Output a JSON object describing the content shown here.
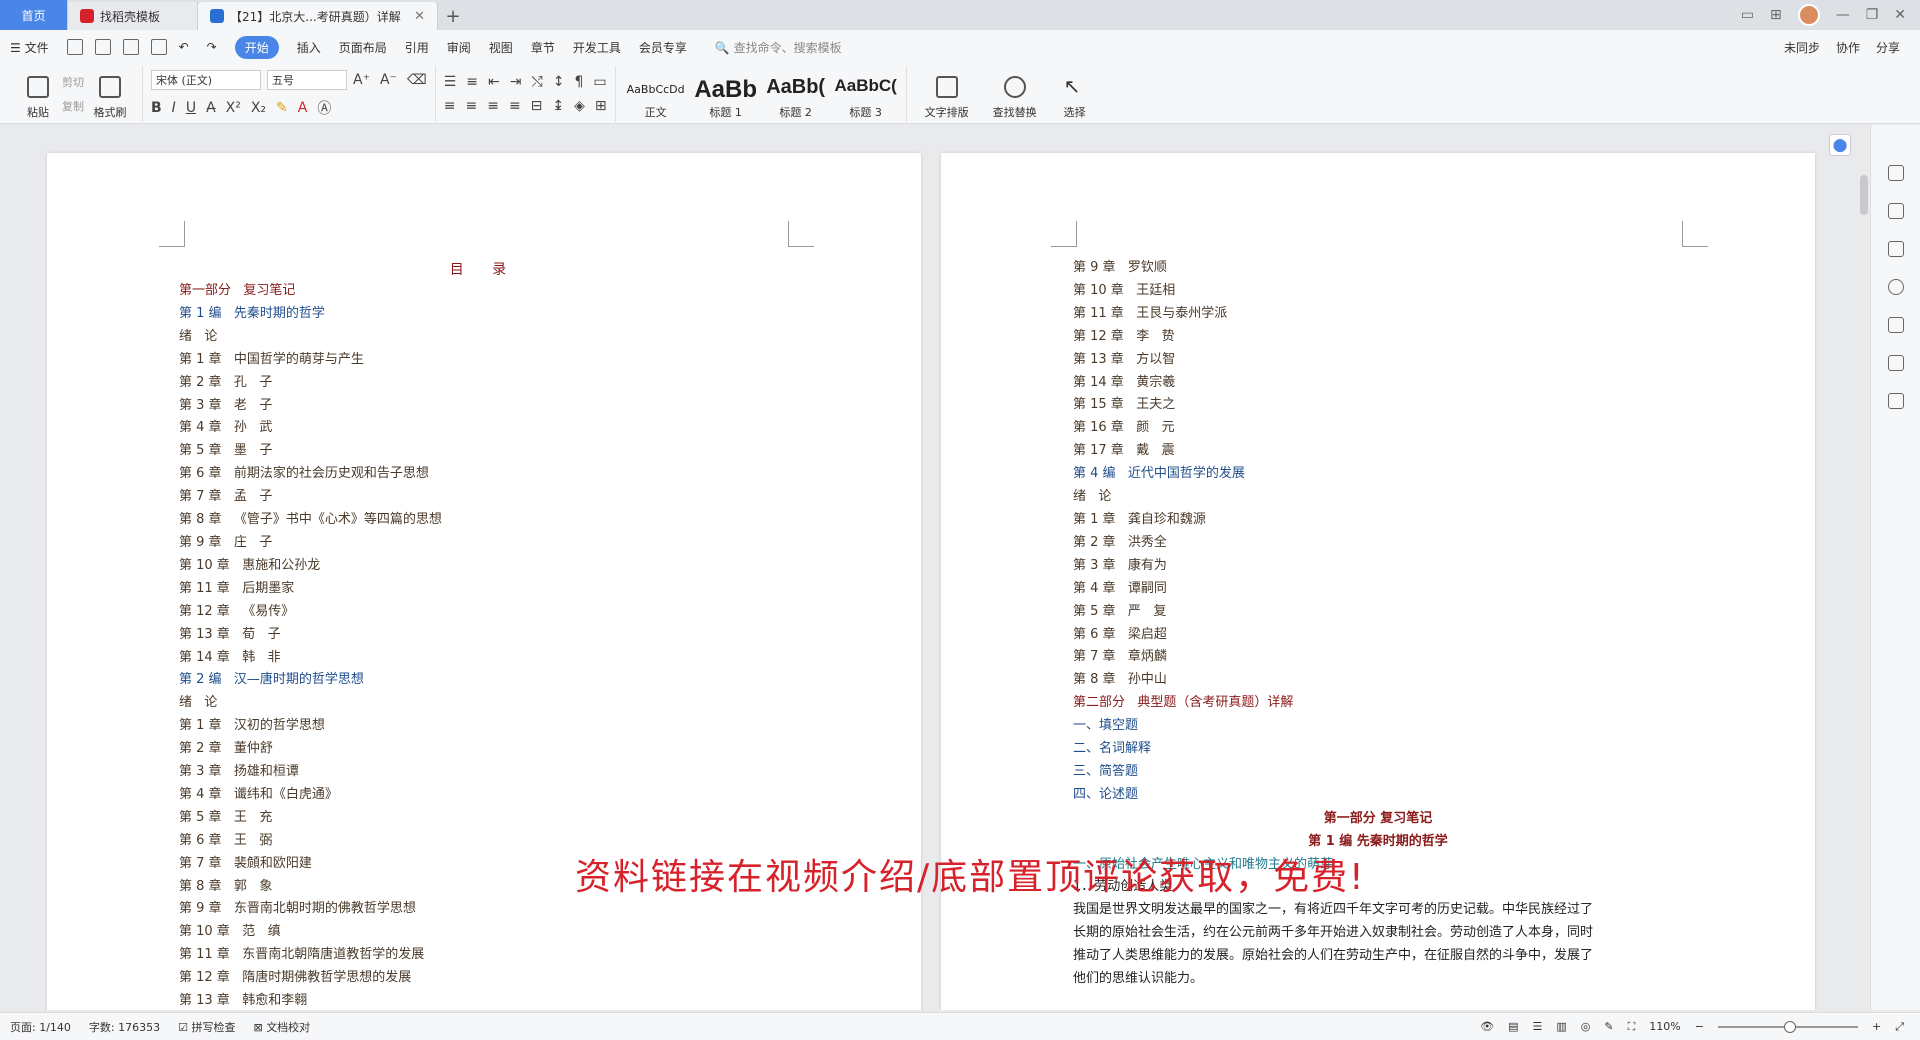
{
  "tabs": {
    "home": "首页",
    "template": "找稻壳模板",
    "doc": "【21】北京大...考研真题）详解"
  },
  "menu": {
    "file": "文件",
    "items": [
      "开始",
      "插入",
      "页面布局",
      "引用",
      "审阅",
      "视图",
      "章节",
      "开发工具",
      "会员专享"
    ],
    "search_placeholder": "查找命令、搜索模板",
    "right": [
      "未同步",
      "协作",
      "分享"
    ]
  },
  "ribbon": {
    "paste": "粘贴",
    "cut": "剪切",
    "copy": "复制",
    "format_painter": "格式刷",
    "font": "宋体 (正文)",
    "size": "五号",
    "styles": [
      {
        "sample": "AaBbCcDd",
        "label": "正文"
      },
      {
        "sample": "AaBb",
        "label": "标题 1"
      },
      {
        "sample": "AaBb(",
        "label": "标题 2"
      },
      {
        "sample": "AaBbC(",
        "label": "标题 3"
      }
    ],
    "text_layout": "文字排版",
    "find_replace": "查找替换",
    "select": "选择"
  },
  "page1": {
    "title": "目  录",
    "lines": [
      {
        "t": "第一部分   复习笔记",
        "c": "red"
      },
      {
        "t": "第 1 编   先秦时期的哲学",
        "c": "blue"
      },
      {
        "t": "绪   论",
        "c": "dark"
      },
      {
        "t": "第 1 章   中国哲学的萌芽与产生",
        "c": "dark"
      },
      {
        "t": "第 2 章   孔   子",
        "c": "dark"
      },
      {
        "t": "第 3 章   老   子",
        "c": "dark"
      },
      {
        "t": "第 4 章   孙   武",
        "c": "dark"
      },
      {
        "t": "第 5 章   墨   子",
        "c": "dark"
      },
      {
        "t": "第 6 章   前期法家的社会历史观和告子思想",
        "c": "dark"
      },
      {
        "t": "第 7 章   孟   子",
        "c": "dark"
      },
      {
        "t": "第 8 章   《管子》书中《心术》等四篇的思想",
        "c": "dark"
      },
      {
        "t": "第 9 章   庄   子",
        "c": "dark"
      },
      {
        "t": "第 10 章   惠施和公孙龙",
        "c": "dark"
      },
      {
        "t": "第 11 章   后期墨家",
        "c": "dark"
      },
      {
        "t": "第 12 章   《易传》",
        "c": "dark"
      },
      {
        "t": "第 13 章   荀   子",
        "c": "dark"
      },
      {
        "t": "第 14 章   韩   非",
        "c": "dark"
      },
      {
        "t": "第 2 编   汉—唐时期的哲学思想",
        "c": "blue"
      },
      {
        "t": "绪   论",
        "c": "dark"
      },
      {
        "t": "第 1 章   汉初的哲学思想",
        "c": "dark"
      },
      {
        "t": "第 2 章   董仲舒",
        "c": "dark"
      },
      {
        "t": "第 3 章   扬雄和桓谭",
        "c": "dark"
      },
      {
        "t": "第 4 章   谶纬和《白虎通》",
        "c": "dark"
      },
      {
        "t": "第 5 章   王   充",
        "c": "dark"
      },
      {
        "t": "第 6 章   王   弼",
        "c": "dark"
      },
      {
        "t": "第 7 章   裴頠和欧阳建",
        "c": "dark"
      },
      {
        "t": "第 8 章   郭   象",
        "c": "dark"
      },
      {
        "t": "第 9 章   东晋南北朝时期的佛教哲学思想",
        "c": "dark"
      },
      {
        "t": "第 10 章   范   缜",
        "c": "dark"
      },
      {
        "t": "第 11 章   东晋南北朝隋唐道教哲学的发展",
        "c": "dark"
      },
      {
        "t": "第 12 章   隋唐时期佛教哲学思想的发展",
        "c": "dark"
      },
      {
        "t": "第 13 章   韩愈和李翱",
        "c": "dark"
      }
    ]
  },
  "page2": {
    "lines": [
      {
        "t": "第 9 章   罗钦顺",
        "c": "dark"
      },
      {
        "t": "第 10 章   王廷相",
        "c": "dark"
      },
      {
        "t": "第 11 章   王艮与泰州学派",
        "c": "dark"
      },
      {
        "t": "第 12 章   李   贽",
        "c": "dark"
      },
      {
        "t": "第 13 章   方以智",
        "c": "dark"
      },
      {
        "t": "第 14 章   黄宗羲",
        "c": "dark"
      },
      {
        "t": "第 15 章   王夫之",
        "c": "dark"
      },
      {
        "t": "第 16 章   颜   元",
        "c": "dark"
      },
      {
        "t": "第 17 章   戴   震",
        "c": "dark"
      },
      {
        "t": "第 4 编   近代中国哲学的发展",
        "c": "blue"
      },
      {
        "t": "绪   论",
        "c": "dark"
      },
      {
        "t": "第 1 章   龚自珍和魏源",
        "c": "dark"
      },
      {
        "t": "第 2 章   洪秀全",
        "c": "dark"
      },
      {
        "t": "第 3 章   康有为",
        "c": "dark"
      },
      {
        "t": "第 4 章   谭嗣同",
        "c": "dark"
      },
      {
        "t": "第 5 章   严   复",
        "c": "dark"
      },
      {
        "t": "第 6 章   梁启超",
        "c": "dark"
      },
      {
        "t": "第 7 章   章炳麟",
        "c": "dark"
      },
      {
        "t": "第 8 章   孙中山",
        "c": "dark"
      },
      {
        "t": "第二部分   典型题（含考研真题）详解",
        "c": "red"
      },
      {
        "t": "一、填空题",
        "c": "blue"
      },
      {
        "t": "二、名词解释",
        "c": "blue"
      },
      {
        "t": "三、简答题",
        "c": "blue"
      },
      {
        "t": "四、论述题",
        "c": "blue"
      }
    ],
    "heading1": "第一部分   复习笔记",
    "heading2": "第 1 编   先秦时期的哲学",
    "section": "一、原始社会产生唯心主义和唯物主义的萌芽",
    "sub": "1．劳动创造人类",
    "para": [
      "我国是世界文明发达最早的国家之一，有将近四千年文字可考的历史记载。中华民族经过了",
      "长期的原始社会生活，约在公元前两千多年开始进入奴隶制社会。劳动创造了人本身，同时",
      "推动了人类思维能力的发展。原始社会的人们在劳动生产中，在征服自然的斗争中，发展了",
      "他们的思维认识能力。"
    ]
  },
  "overlay": "资料链接在视频介绍/底部置顶评论获取，免费!",
  "status": {
    "page": "页面: 1/140",
    "words": "字数: 176353",
    "spell": "拼写检查",
    "proof": "文档校对",
    "zoom": "110%"
  }
}
